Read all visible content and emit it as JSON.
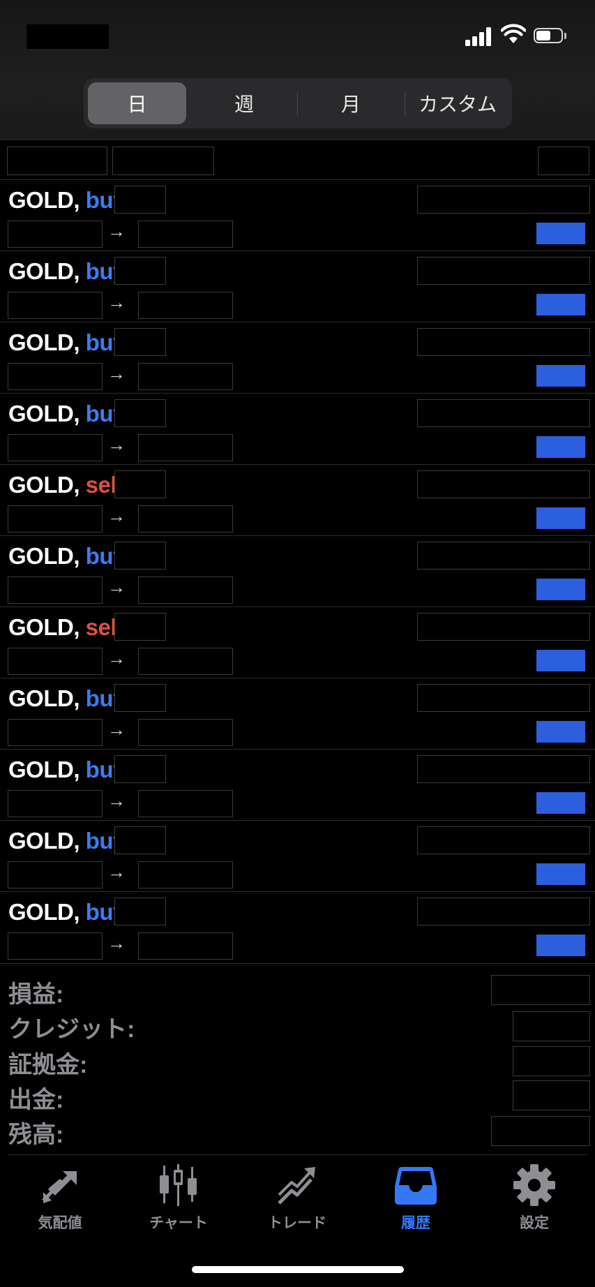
{
  "period_tabs": [
    {
      "label": "日",
      "selected": true
    },
    {
      "label": "週",
      "selected": false
    },
    {
      "label": "月",
      "selected": false
    },
    {
      "label": "カスタム",
      "selected": false
    }
  ],
  "rows": [
    {
      "symbol": "GOLD",
      "comma": ",",
      "side": "buy"
    },
    {
      "symbol": "GOLD",
      "comma": ",",
      "side": "buy"
    },
    {
      "symbol": "GOLD",
      "comma": ",",
      "side": "buy"
    },
    {
      "symbol": "GOLD",
      "comma": ",",
      "side": "buy"
    },
    {
      "symbol": "GOLD",
      "comma": ",",
      "side": "sell"
    },
    {
      "symbol": "GOLD",
      "comma": ",",
      "side": "buy"
    },
    {
      "symbol": "GOLD",
      "comma": ",",
      "side": "sell"
    },
    {
      "symbol": "GOLD",
      "comma": ",",
      "side": "buy"
    },
    {
      "symbol": "GOLD",
      "comma": ",",
      "side": "buy"
    },
    {
      "symbol": "GOLD",
      "comma": ",",
      "side": "buy"
    },
    {
      "symbol": "GOLD",
      "comma": ",",
      "side": "buy"
    }
  ],
  "arrow_glyph": "→",
  "summary": {
    "profit": "損益:",
    "credit": "クレジット:",
    "margin": "証拠金:",
    "withdrawal": "出金:",
    "balance": "残高:"
  },
  "tabbar": [
    {
      "label": "気配値",
      "icon": "quotes-arrows-icon",
      "active": false
    },
    {
      "label": "チャート",
      "icon": "candlestick-chart-icon",
      "active": false
    },
    {
      "label": "トレード",
      "icon": "trade-trend-icon",
      "active": false
    },
    {
      "label": "履歴",
      "icon": "history-inbox-icon",
      "active": true
    },
    {
      "label": "設定",
      "icon": "settings-gear-icon",
      "active": false
    }
  ],
  "colors": {
    "buy": "#3d7bf0",
    "sell": "#e0503f",
    "accent": "#3478f6",
    "profit_badge": "#2b5fde"
  }
}
